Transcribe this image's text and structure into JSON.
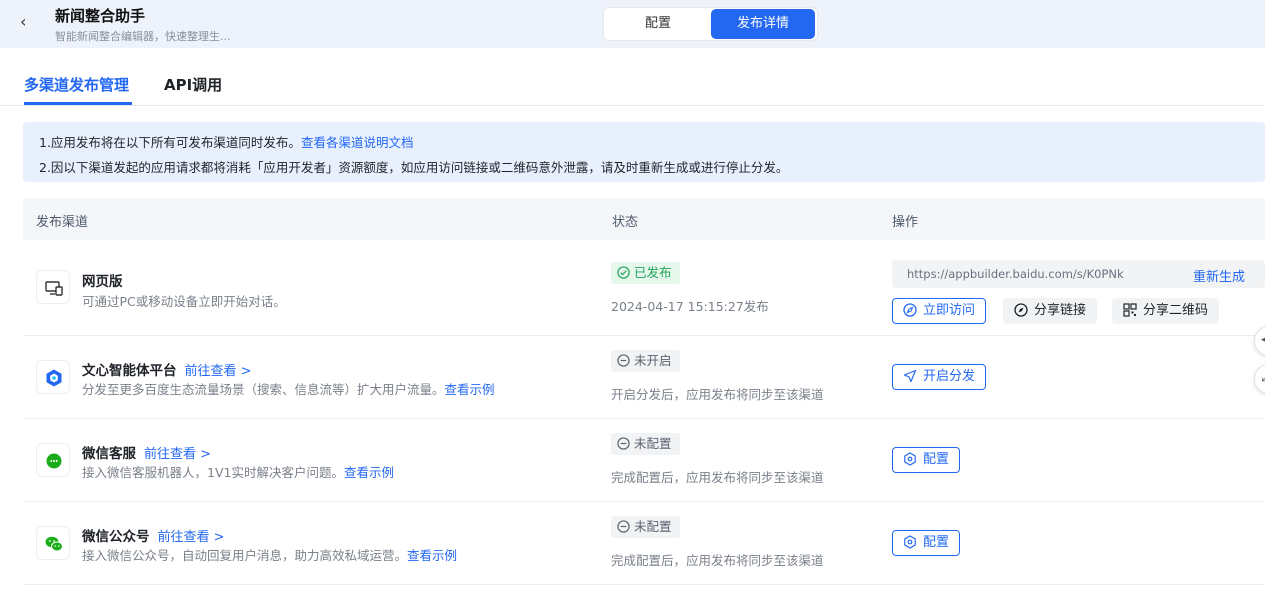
{
  "header": {
    "title": "新闻整合助手",
    "subtitle": "智能新闻整合编辑器，快速整理生...",
    "segments": [
      "配置",
      "发布详情"
    ],
    "active_segment": "发布详情"
  },
  "tabs": [
    {
      "label": "多渠道发布管理",
      "active": true
    },
    {
      "label": "API调用",
      "active": false
    }
  ],
  "notice": {
    "line1_text": "1.应用发布将在以下所有可发布渠道同时发布。",
    "line1_link": "查看各渠道说明文档",
    "line2_text": "2.因以下渠道发起的应用请求都将消耗「应用开发者」资源额度，如应用访问链接或二维码意外泄露，请及时重新生成或进行停止分发。"
  },
  "table": {
    "headers": [
      "发布渠道",
      "状态",
      "操作"
    ],
    "rows": [
      {
        "name": "网页版",
        "desc": "可通过PC或移动设备立即开始对话。",
        "icon": "monitor-phone-icon",
        "status": "已发布",
        "status_sub": "2024-04-17 15:15:27发布",
        "url": "https://appbuilder.baidu.com/s/K0PNk",
        "regen": "重新生成",
        "actions": [
          "立即访问",
          "分享链接",
          "分享二维码"
        ]
      },
      {
        "name": "文心智能体平台",
        "go": "前往查看 >",
        "desc": "分发至更多百度生态流量场景（搜索、信息流等）扩大用户流量。",
        "example": "查看示例",
        "icon": "wenxin-agent-icon",
        "status": "未开启",
        "status_sub": "开启分发后，应用发布将同步至该渠道",
        "action": "开启分发"
      },
      {
        "name": "微信客服",
        "go": "前往查看 >",
        "desc": "接入微信客服机器人，1V1实时解决客户问题。",
        "example": "查看示例",
        "icon": "wechat-service-icon",
        "status": "未配置",
        "status_sub": "完成配置后，应用发布将同步至该渠道",
        "action": "配置"
      },
      {
        "name": "微信公众号",
        "go": "前往查看 >",
        "desc": "接入微信公众号，自动回复用户消息，助力高效私域运营。",
        "example": "查看示例",
        "icon": "wechat-official-icon",
        "status": "未配置",
        "status_sub": "完成配置后，应用发布将同步至该渠道",
        "action": "配置"
      }
    ]
  },
  "colors": {
    "accent": "#2468f2",
    "success": "#23a35a",
    "wechat_green": "#1aad19"
  }
}
